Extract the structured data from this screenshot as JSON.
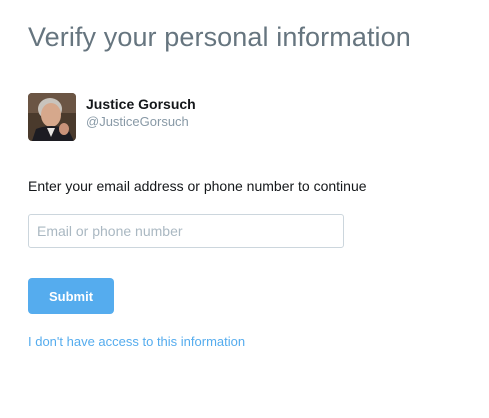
{
  "page": {
    "title": "Verify your personal information"
  },
  "account": {
    "display_name": "Justice Gorsuch",
    "handle": "@JusticeGorsuch"
  },
  "form": {
    "prompt": "Enter your email address or phone number to continue",
    "input_placeholder": "Email or phone number",
    "input_value": "",
    "submit_label": "Submit",
    "no_access_link": "I don't have access to this information"
  },
  "colors": {
    "accent": "#55acee",
    "title": "#66757f",
    "text": "#14171a",
    "muted": "#8899a6",
    "input_border": "#ccd6dd"
  }
}
